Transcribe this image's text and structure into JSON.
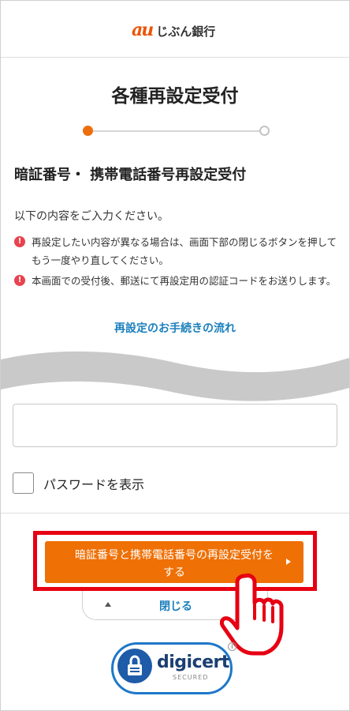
{
  "header": {
    "logo_mark": "au",
    "logo_name": "じぶん銀行"
  },
  "page": {
    "title": "各種再設定受付",
    "stepper": {
      "current_step": 1,
      "total_steps": 2
    },
    "subtitle": "暗証番号・ 携帯電話番号再設定受付",
    "intro": "以下の内容をご入力ください。",
    "notes": [
      "再設定したい内容が異なる場合は、画面下部の閉じるボタンを押してもう一度やり直してください。",
      "本画面での受付後、郵送にて再設定用の認証コードをお送りします。"
    ],
    "flow_link": "再設定のお手続きの流れ"
  },
  "form": {
    "password_value": "",
    "show_password_label": "パスワードを表示",
    "show_password_checked": false
  },
  "actions": {
    "submit_label": "暗証番号と携帯電話番号の再設定受付をする",
    "close_label": "閉じる"
  },
  "seal": {
    "brand": "digicert",
    "tag": "SECURED"
  },
  "colors": {
    "accent": "#ef7005",
    "link": "#1a7fbd",
    "highlight": "#e60012",
    "warning": "#e8434f"
  }
}
